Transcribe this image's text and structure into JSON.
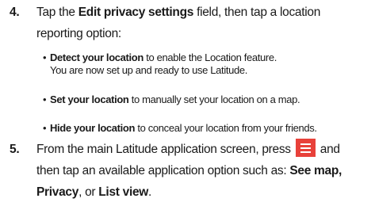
{
  "step4": {
    "number": "4.",
    "line1_pre": "Tap the ",
    "line1_bold": "Edit privacy settings",
    "line1_post": " field, then tap a location",
    "line2": "reporting option:"
  },
  "bullets": [
    {
      "bold": "Detect your location",
      "text": " to enable the Location feature.",
      "continuation": "You are now set up and ready to use Latitude."
    },
    {
      "bold": "Set your location",
      "text": " to manually set your location on a map."
    },
    {
      "bold": "Hide your location",
      "text": " to conceal your location from your friends."
    }
  ],
  "step5": {
    "number": "5.",
    "line1_pre": "From the main Latitude application screen, press",
    "line1_post": "and",
    "menu_icon": "menu-icon",
    "line2_pre": "then tap an available application option such as: ",
    "line2_bold": "See map,",
    "line3_bold1": "Privacy",
    "line3_mid": ", or ",
    "line3_bold2": "List view",
    "line3_end": "."
  },
  "colors": {
    "menu_key": "#e8413a"
  }
}
